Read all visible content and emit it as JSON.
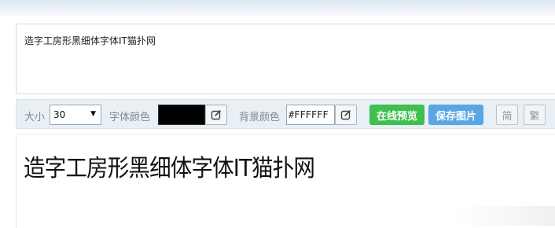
{
  "editor": {
    "text": "造字工房形黑细体字体IT猫扑网"
  },
  "toolbar": {
    "size_label": "大小",
    "size_value": "30",
    "font_color_label": "字体颜色",
    "font_color": "#000000",
    "bg_color_label": "背景颜色",
    "bg_color_value": "#FFFFFF",
    "preview_button": "在线预览",
    "save_button": "保存图片",
    "simplified_button": "简",
    "traditional_button": "繁"
  },
  "preview": {
    "text": "造字工房形黑细体字体IT猫扑网"
  },
  "colors": {
    "preview_button": "#3fbf4f",
    "save_button": "#5aa6e4"
  }
}
